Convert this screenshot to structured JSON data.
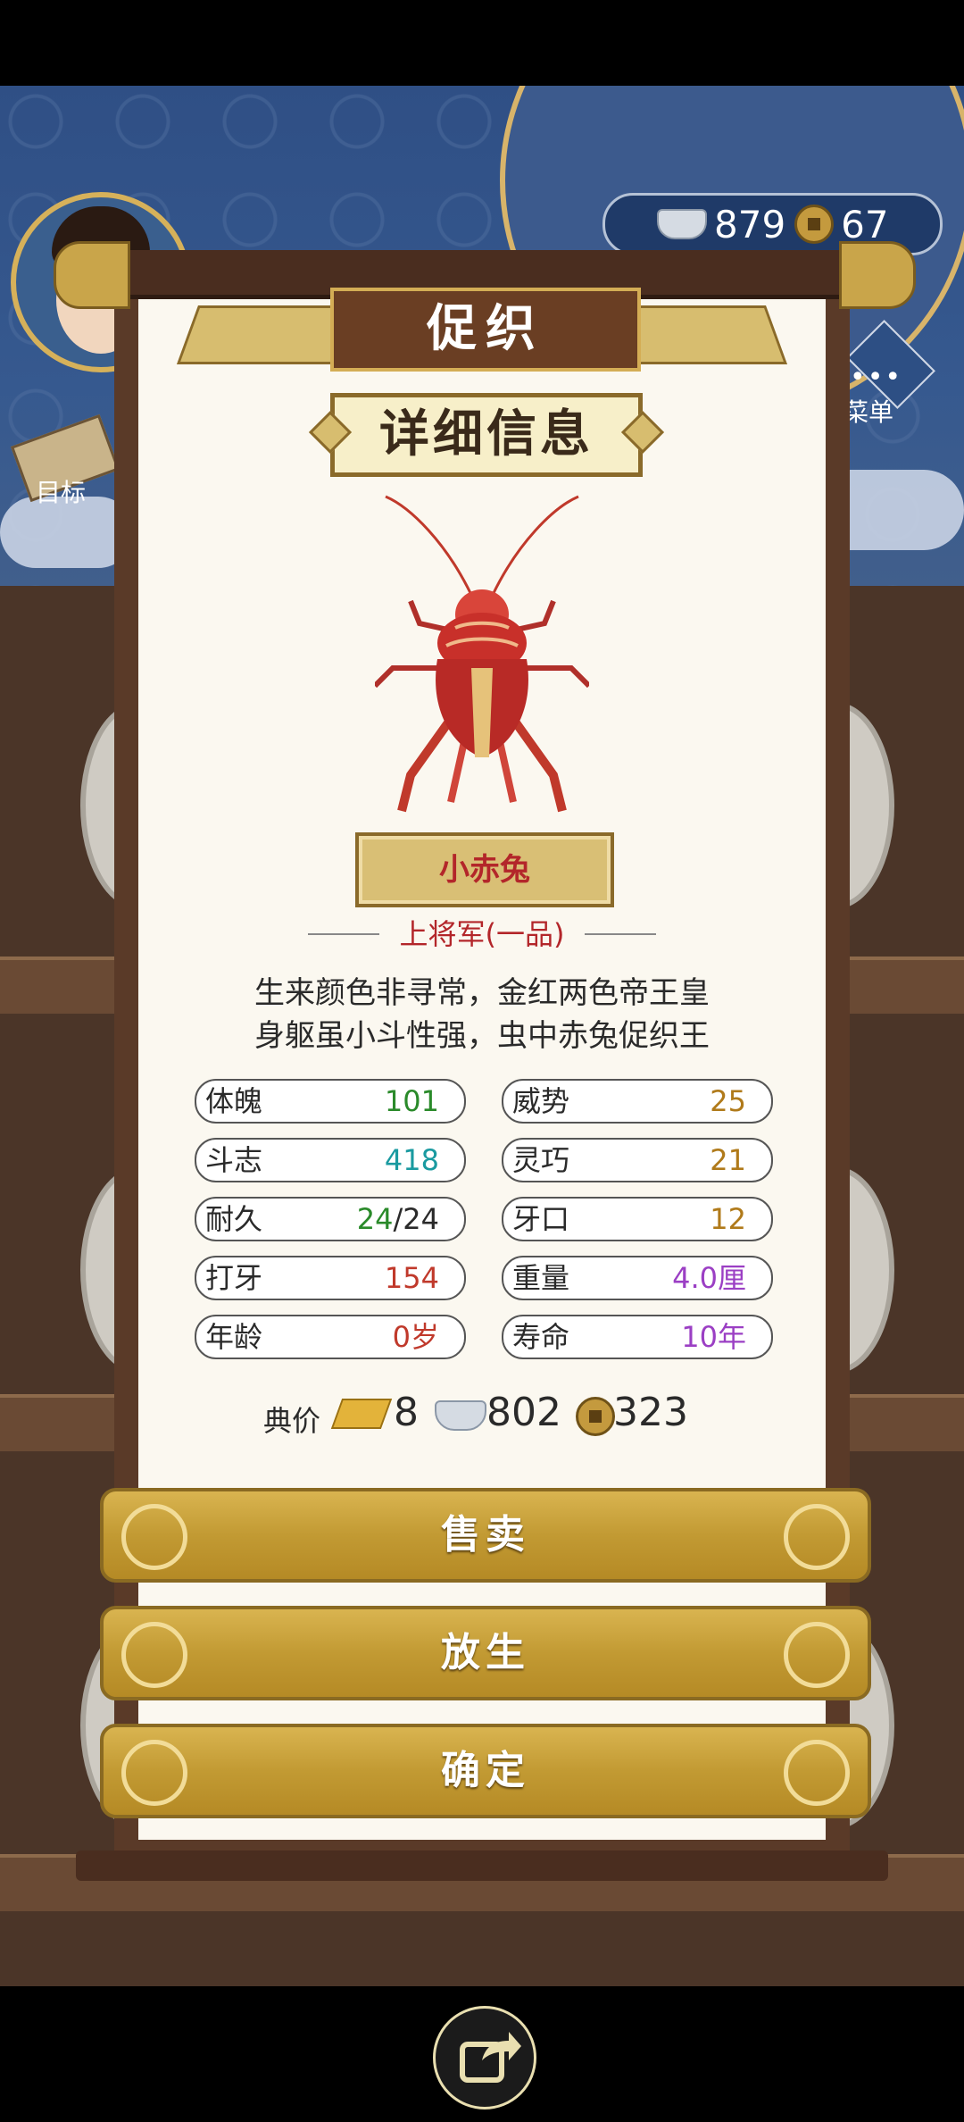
{
  "hud": {
    "silver_count": "879",
    "coin_count": "67",
    "goal_label": "目标",
    "menu_label": "菜单",
    "menu_dots": "•••"
  },
  "panel": {
    "title": "促织",
    "subtitle": "详细信息",
    "cricket_name": "小赤兔",
    "rank": "上将军(一品)",
    "poem_line1": "生来颜色非寻常，金红两色帝王皇",
    "poem_line2": "身躯虽小斗性强，虫中赤兔促织王",
    "stats": [
      {
        "label": "体魄",
        "value": "101",
        "color": "#2a8a2a"
      },
      {
        "label": "威势",
        "value": "25",
        "color": "#b07a1a"
      },
      {
        "label": "斗志",
        "value": "418",
        "color": "#1a9aa0"
      },
      {
        "label": "灵巧",
        "value": "21",
        "color": "#b07a1a"
      },
      {
        "label": "耐久",
        "value": "24",
        "value2": "/24",
        "color": "#2a8a2a",
        "color2": "#2a2a2a"
      },
      {
        "label": "牙口",
        "value": "12",
        "color": "#b07a1a"
      },
      {
        "label": "打牙",
        "value": "154",
        "color": "#c0392b"
      },
      {
        "label": "重量",
        "value": "4.0厘",
        "color": "#9b3fc4"
      },
      {
        "label": "年龄",
        "value": "0岁",
        "color": "#c0392b"
      },
      {
        "label": "寿命",
        "value": "10年",
        "color": "#9b3fc4"
      }
    ],
    "price": {
      "label": "典价",
      "gold": "8",
      "silver": "802",
      "coins": "323"
    }
  },
  "buttons": {
    "sell": "售卖",
    "release": "放生",
    "confirm": "确定"
  },
  "icons": [
    "silver-ingot-icon",
    "copper-coin-icon",
    "gold-bar-icon",
    "share-icon",
    "menu-icon",
    "goal-scroll-icon"
  ]
}
